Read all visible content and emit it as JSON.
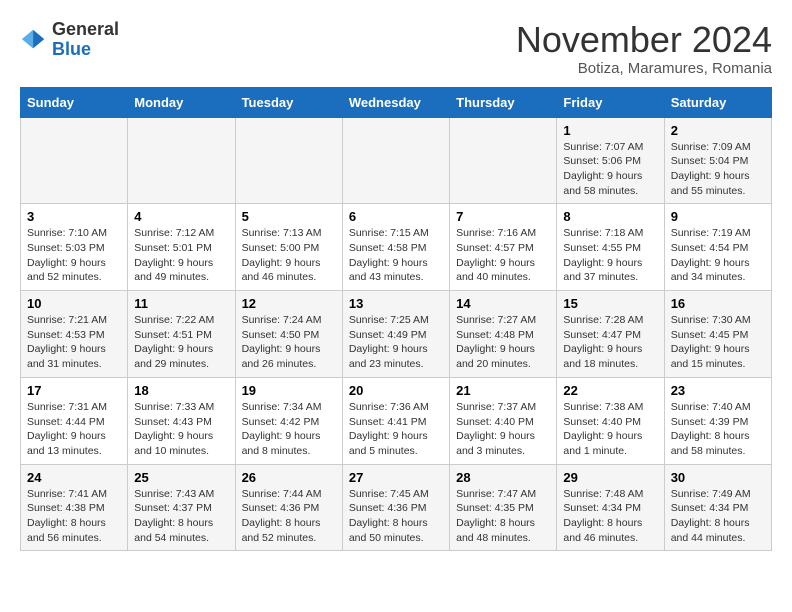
{
  "logo": {
    "general": "General",
    "blue": "Blue"
  },
  "header": {
    "month": "November 2024",
    "location": "Botiza, Maramures, Romania"
  },
  "weekdays": [
    "Sunday",
    "Monday",
    "Tuesday",
    "Wednesday",
    "Thursday",
    "Friday",
    "Saturday"
  ],
  "weeks": [
    [
      {
        "day": "",
        "info": ""
      },
      {
        "day": "",
        "info": ""
      },
      {
        "day": "",
        "info": ""
      },
      {
        "day": "",
        "info": ""
      },
      {
        "day": "",
        "info": ""
      },
      {
        "day": "1",
        "info": "Sunrise: 7:07 AM\nSunset: 5:06 PM\nDaylight: 9 hours and 58 minutes."
      },
      {
        "day": "2",
        "info": "Sunrise: 7:09 AM\nSunset: 5:04 PM\nDaylight: 9 hours and 55 minutes."
      }
    ],
    [
      {
        "day": "3",
        "info": "Sunrise: 7:10 AM\nSunset: 5:03 PM\nDaylight: 9 hours and 52 minutes."
      },
      {
        "day": "4",
        "info": "Sunrise: 7:12 AM\nSunset: 5:01 PM\nDaylight: 9 hours and 49 minutes."
      },
      {
        "day": "5",
        "info": "Sunrise: 7:13 AM\nSunset: 5:00 PM\nDaylight: 9 hours and 46 minutes."
      },
      {
        "day": "6",
        "info": "Sunrise: 7:15 AM\nSunset: 4:58 PM\nDaylight: 9 hours and 43 minutes."
      },
      {
        "day": "7",
        "info": "Sunrise: 7:16 AM\nSunset: 4:57 PM\nDaylight: 9 hours and 40 minutes."
      },
      {
        "day": "8",
        "info": "Sunrise: 7:18 AM\nSunset: 4:55 PM\nDaylight: 9 hours and 37 minutes."
      },
      {
        "day": "9",
        "info": "Sunrise: 7:19 AM\nSunset: 4:54 PM\nDaylight: 9 hours and 34 minutes."
      }
    ],
    [
      {
        "day": "10",
        "info": "Sunrise: 7:21 AM\nSunset: 4:53 PM\nDaylight: 9 hours and 31 minutes."
      },
      {
        "day": "11",
        "info": "Sunrise: 7:22 AM\nSunset: 4:51 PM\nDaylight: 9 hours and 29 minutes."
      },
      {
        "day": "12",
        "info": "Sunrise: 7:24 AM\nSunset: 4:50 PM\nDaylight: 9 hours and 26 minutes."
      },
      {
        "day": "13",
        "info": "Sunrise: 7:25 AM\nSunset: 4:49 PM\nDaylight: 9 hours and 23 minutes."
      },
      {
        "day": "14",
        "info": "Sunrise: 7:27 AM\nSunset: 4:48 PM\nDaylight: 9 hours and 20 minutes."
      },
      {
        "day": "15",
        "info": "Sunrise: 7:28 AM\nSunset: 4:47 PM\nDaylight: 9 hours and 18 minutes."
      },
      {
        "day": "16",
        "info": "Sunrise: 7:30 AM\nSunset: 4:45 PM\nDaylight: 9 hours and 15 minutes."
      }
    ],
    [
      {
        "day": "17",
        "info": "Sunrise: 7:31 AM\nSunset: 4:44 PM\nDaylight: 9 hours and 13 minutes."
      },
      {
        "day": "18",
        "info": "Sunrise: 7:33 AM\nSunset: 4:43 PM\nDaylight: 9 hours and 10 minutes."
      },
      {
        "day": "19",
        "info": "Sunrise: 7:34 AM\nSunset: 4:42 PM\nDaylight: 9 hours and 8 minutes."
      },
      {
        "day": "20",
        "info": "Sunrise: 7:36 AM\nSunset: 4:41 PM\nDaylight: 9 hours and 5 minutes."
      },
      {
        "day": "21",
        "info": "Sunrise: 7:37 AM\nSunset: 4:40 PM\nDaylight: 9 hours and 3 minutes."
      },
      {
        "day": "22",
        "info": "Sunrise: 7:38 AM\nSunset: 4:40 PM\nDaylight: 9 hours and 1 minute."
      },
      {
        "day": "23",
        "info": "Sunrise: 7:40 AM\nSunset: 4:39 PM\nDaylight: 8 hours and 58 minutes."
      }
    ],
    [
      {
        "day": "24",
        "info": "Sunrise: 7:41 AM\nSunset: 4:38 PM\nDaylight: 8 hours and 56 minutes."
      },
      {
        "day": "25",
        "info": "Sunrise: 7:43 AM\nSunset: 4:37 PM\nDaylight: 8 hours and 54 minutes."
      },
      {
        "day": "26",
        "info": "Sunrise: 7:44 AM\nSunset: 4:36 PM\nDaylight: 8 hours and 52 minutes."
      },
      {
        "day": "27",
        "info": "Sunrise: 7:45 AM\nSunset: 4:36 PM\nDaylight: 8 hours and 50 minutes."
      },
      {
        "day": "28",
        "info": "Sunrise: 7:47 AM\nSunset: 4:35 PM\nDaylight: 8 hours and 48 minutes."
      },
      {
        "day": "29",
        "info": "Sunrise: 7:48 AM\nSunset: 4:34 PM\nDaylight: 8 hours and 46 minutes."
      },
      {
        "day": "30",
        "info": "Sunrise: 7:49 AM\nSunset: 4:34 PM\nDaylight: 8 hours and 44 minutes."
      }
    ]
  ]
}
